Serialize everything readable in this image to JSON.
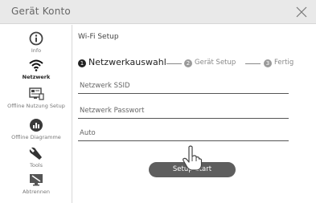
{
  "window": {
    "title": "Gerät Konto",
    "close_icon": "close-icon"
  },
  "sidebar": {
    "items": [
      {
        "label": "Info",
        "icon": "info-icon",
        "active": false
      },
      {
        "label": "Netzwerk",
        "icon": "wifi-icon",
        "active": true
      },
      {
        "label": "Offline Nutzung Setup",
        "icon": "offline-setup-icon",
        "active": false
      },
      {
        "label": "Offline Diagramme",
        "icon": "chart-icon",
        "active": false
      },
      {
        "label": "Tools",
        "icon": "wrench-icon",
        "active": false
      },
      {
        "label": "Abtrennen",
        "icon": "disconnect-monitor-icon",
        "active": false
      }
    ]
  },
  "main": {
    "heading": "Wi-Fi Setup",
    "steps": [
      {
        "number": "1",
        "label": "Netzwerkauswahl",
        "active": true
      },
      {
        "number": "2",
        "label": "Gerät Setup",
        "active": false
      },
      {
        "number": "3",
        "label": "Fertig",
        "active": false
      }
    ],
    "fields": {
      "ssid_placeholder": "Netzwerk SSID",
      "password_placeholder": "Netzwerk Passwort",
      "mode_value": "Auto"
    },
    "start_button": "Setup Start"
  },
  "colors": {
    "titlebar": "#e9e9e9",
    "button": "#5e5e5e",
    "active_step": "#222222",
    "inactive_step": "#9a9a9a"
  }
}
